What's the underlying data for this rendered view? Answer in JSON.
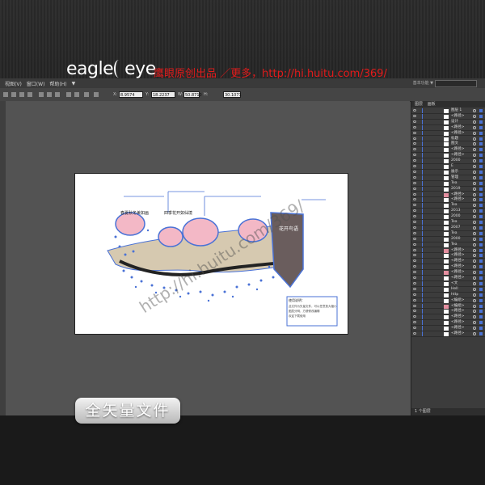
{
  "brand": {
    "name_left": "eagle",
    "name_right": "eye",
    "tagline": "鹰眼原创出品 ／更多，http://hi.huitu.com/369/"
  },
  "menubar": {
    "items": [
      "视图(V)",
      "窗口(W)",
      "帮助(H)",
      "▼"
    ],
    "workspace": "基本功能 ▼",
    "search_placeholder": "🔍"
  },
  "controlbar": {
    "fields": [
      {
        "label": "X:",
        "value": "8.9574"
      },
      {
        "label": "Y:",
        "value": "18.2237"
      },
      {
        "label": "W:",
        "value": "50.8710"
      },
      {
        "label": "H:",
        "value": "30.1071"
      }
    ]
  },
  "artboard": {
    "bubble_labels": [
      "春夏秋冬美如画",
      "四季花开如仙境"
    ],
    "side_label": "花开鸟语",
    "note_title": "使用说明：",
    "note_lines": [
      "此文件为矢量文件，可以任意放大缩小",
      "图层分明，方便修改编辑",
      "欢迎下载使用"
    ]
  },
  "layers_panel": {
    "tabs": [
      "图层",
      "画板"
    ],
    "items": [
      {
        "name": "图层 1",
        "thumb": "#ffffff"
      },
      {
        "name": "<路径>",
        "thumb": "#ffffff"
      },
      {
        "name": "设计",
        "thumb": "#ffffff"
      },
      {
        "name": "<路径>",
        "thumb": "#ffffff"
      },
      {
        "name": "<路径>",
        "thumb": "#ffffff"
      },
      {
        "name": "标题",
        "thumb": "#ffffff"
      },
      {
        "name": "图文",
        "thumb": "#ffffff"
      },
      {
        "name": "<路径>",
        "thumb": "#ffffff"
      },
      {
        "name": "<路径>",
        "thumb": "#ffffff"
      },
      {
        "name": "2000",
        "thumb": "#ffffff"
      },
      {
        "name": "E",
        "thumb": "#ffffff"
      },
      {
        "name": "展示",
        "thumb": "#ffffff"
      },
      {
        "name": "管理",
        "thumb": "#ffffff"
      },
      {
        "name": "Tea",
        "thumb": "#ffffff"
      },
      {
        "name": "2019",
        "thumb": "#ffffff"
      },
      {
        "name": "<路径>",
        "thumb": "#e58fa0"
      },
      {
        "name": "<路径>",
        "thumb": "#ffffff"
      },
      {
        "name": "Tea",
        "thumb": "#ffffff"
      },
      {
        "name": "2013",
        "thumb": "#ffffff"
      },
      {
        "name": "2000",
        "thumb": "#ffffff"
      },
      {
        "name": "Tea",
        "thumb": "#ffffff"
      },
      {
        "name": "2007",
        "thumb": "#ffffff"
      },
      {
        "name": "Tea",
        "thumb": "#ffffff"
      },
      {
        "name": "2000",
        "thumb": "#ffffff"
      },
      {
        "name": "Tea",
        "thumb": "#ffffff"
      },
      {
        "name": "<路径>",
        "thumb": "#e58fa0"
      },
      {
        "name": "<路径>",
        "thumb": "#ffffff"
      },
      {
        "name": "<路径>",
        "thumb": "#ffffff"
      },
      {
        "name": "<路径>",
        "thumb": "#ffffff"
      },
      {
        "name": "<路径>",
        "thumb": "#e58fa0"
      },
      {
        "name": "<路径>",
        "thumb": "#ffffff"
      },
      {
        "name": "<文",
        "thumb": "#ffffff"
      },
      {
        "name": "Hell",
        "thumb": "#ffffff"
      },
      {
        "name": "http",
        "thumb": "#ffffff"
      },
      {
        "name": "<编组>",
        "thumb": "#ffffff"
      },
      {
        "name": "<编组>",
        "thumb": "#e58fa0"
      },
      {
        "name": "<路径>",
        "thumb": "#ffffff"
      },
      {
        "name": "<路径>",
        "thumb": "#ffffff"
      },
      {
        "name": "<路径>",
        "thumb": "#ffffff"
      },
      {
        "name": "<路径>",
        "thumb": "#ffffff"
      },
      {
        "name": "<路径>",
        "thumb": "#ffffff"
      }
    ],
    "status": "1 个图层"
  },
  "watermark": {
    "pill_text": "全矢量文件",
    "url_text": "http://hi.huitu.com/369/"
  },
  "colors": {
    "accent_blue": "#4a72d6",
    "bubble_pink": "#f3b8c6",
    "ground_tan": "#d6c9b0",
    "tagline_red": "#e11b1b"
  }
}
